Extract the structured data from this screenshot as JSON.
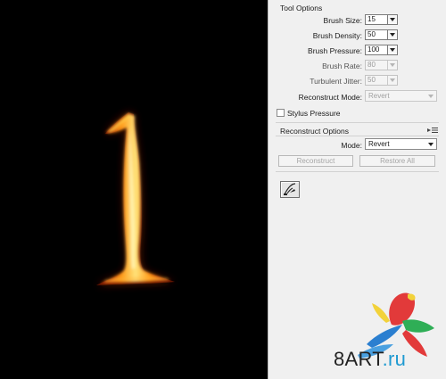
{
  "tool_options": {
    "title": "Tool Options",
    "brush_size": {
      "label": "Brush Size:",
      "value": "15"
    },
    "brush_density": {
      "label": "Brush Density:",
      "value": "50"
    },
    "brush_pressure": {
      "label": "Brush Pressure:",
      "value": "100"
    },
    "brush_rate": {
      "label": "Brush Rate:",
      "value": "80",
      "disabled": true
    },
    "turbulent_jitter": {
      "label": "Turbulent Jitter:",
      "value": "50",
      "disabled": true
    },
    "reconstruct_mode": {
      "label": "Reconstruct Mode:",
      "value": "Revert",
      "disabled": true
    },
    "stylus_pressure": {
      "label": "Stylus Pressure",
      "checked": false
    }
  },
  "reconstruct_options": {
    "title": "Reconstruct Options",
    "mode": {
      "label": "Mode:",
      "value": "Revert"
    },
    "reconstruct_label": "Reconstruct",
    "restore_all_label": "Restore All"
  },
  "watermark": {
    "part1": "8ART",
    "part2": ".ru"
  },
  "icons": {
    "panel_menu": "panel-menu-icon",
    "tool": "pin-edges-tool-icon",
    "watermark_bird": "parrot-logo-icon"
  },
  "colors": {
    "canvas_bg": "#000000",
    "flame_core": "#ffd23a",
    "flame_edge": "#e0410a",
    "panel_bg": "#f0f0f0"
  }
}
